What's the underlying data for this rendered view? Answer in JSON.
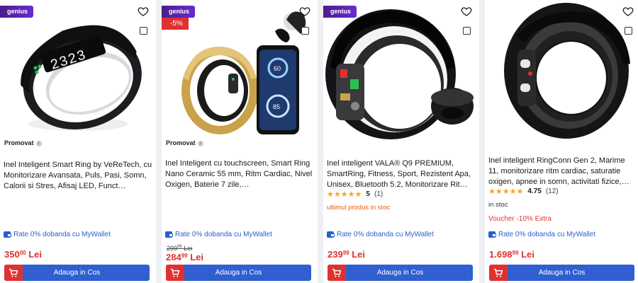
{
  "products": [
    {
      "genius": "genius",
      "promo": "Promovat",
      "title": "Inel Inteligent Smart Ring by VeReTech, cu Monitorizare Avansata, Puls, Pasi, Somn, Calorii si Stres, Afisaj LED, Funct…",
      "wallet": "Rate 0% dobanda cu MyWallet",
      "price_int": "350",
      "price_dec": "00",
      "currency": "Lei",
      "cart": "Adauga in Cos"
    },
    {
      "genius": "genius",
      "discount": "-5%",
      "promo": "Promovat",
      "title": "Inel Inteligent cu touchscreen, Smart Ring Nano Ceramic 55 mm, Ritm Cardiac, Nivel Oxigen, Baterie 7 zile,…",
      "wallet": "Rate 0% dobanda cu MyWallet",
      "old_int": "299",
      "old_dec": "99",
      "old_currency": "Lei",
      "price_int": "284",
      "price_dec": "99",
      "currency": "Lei",
      "cart": "Adauga in Cos",
      "screen_top": "60",
      "screen_bottom": "85"
    },
    {
      "genius": "genius",
      "title": "Inel inteligent VALA® Q9 PREMIUM, SmartRing, Fitness, Sport, Rezistent Apa, Unisex, Bluetooth 5.2, Monitorizare Rit…",
      "rating_value": "5",
      "rating_count": "(1)",
      "rating_stars": 5,
      "stock": "ultimul produs in stoc",
      "wallet": "Rate 0% dobanda cu MyWallet",
      "price_int": "239",
      "price_dec": "99",
      "currency": "Lei",
      "cart": "Adauga in Cos"
    },
    {
      "title": "Inel inteligent RingConn Gen 2, Marime 11, monitorizare ritm cardiac, saturatie oxigen, apnee in somn, activitati fizice,…",
      "rating_value": "4.75",
      "rating_count": "(12)",
      "rating_stars": 4.75,
      "stock": "in stoc",
      "voucher": "Voucher -10% Extra",
      "wallet": "Rate 0% dobanda cu MyWallet",
      "price_int": "1.698",
      "price_dec": "99",
      "currency": "Lei",
      "cart": "Adauga in Cos"
    }
  ],
  "colors": {
    "cart": "#2f5fd0",
    "price": "#e03131",
    "genius": "#5a24b0",
    "star": "#f3a51c"
  }
}
